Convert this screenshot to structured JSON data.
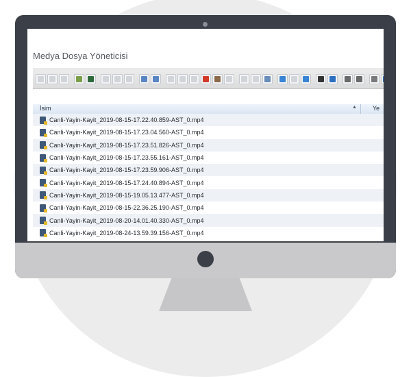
{
  "window": {
    "title": "Medya Dosya Yöneticisi"
  },
  "colors": {
    "accent": "#4a90d9",
    "bezel": "#3b3f47",
    "toolbar": "#e3e3e3"
  },
  "toolbar": {
    "groups": [
      [
        "arrow-left-icon",
        "arrow-right-icon",
        "arrow-up-icon"
      ],
      [
        "new-file-icon",
        "save-icon"
      ],
      [
        "copy-icon",
        "cut-icon",
        "paste-icon"
      ],
      [
        "undo-icon",
        "redo-icon"
      ],
      [
        "select-icon",
        "scissors-icon",
        "duplicate-icon",
        "delete-icon",
        "rename-icon",
        "info-small-icon"
      ],
      [
        "blank-icon",
        "page-icon",
        "search-icon"
      ],
      [
        "view-icons-icon",
        "view-list-icon",
        "view-tiles-icon"
      ],
      [
        "preview-eye-icon",
        "info-icon"
      ],
      [
        "grid-view-icon",
        "sort-icon"
      ],
      [
        "settings-icon",
        "help-icon"
      ]
    ]
  },
  "grid": {
    "columns": {
      "name": "İsim",
      "next": "Ye"
    },
    "files": [
      "Canli-Yayin-Kayit_2019-08-15-17.22.40.859-AST_0.mp4",
      "Canli-Yayin-Kayit_2019-08-15-17.23.04.560-AST_0.mp4",
      "Canli-Yayin-Kayit_2019-08-15-17.23.51.826-AST_0.mp4",
      "Canli-Yayin-Kayit_2019-08-15-17.23.55.161-AST_0.mp4",
      "Canli-Yayin-Kayit_2019-08-15-17.23.59.906-AST_0.mp4",
      "Canli-Yayin-Kayit_2019-08-15-17.24.40.894-AST_0.mp4",
      "Canli-Yayin-Kayit_2019-08-15-19.05.13.477-AST_0.mp4",
      "Canli-Yayin-Kayit_2019-08-15-22.36.25.190-AST_0.mp4",
      "Canli-Yayin-Kayit_2019-08-20-14.01.40.330-AST_0.mp4",
      "Canli-Yayin-Kayit_2019-08-24-13.59.39.156-AST_0.mp4"
    ]
  }
}
